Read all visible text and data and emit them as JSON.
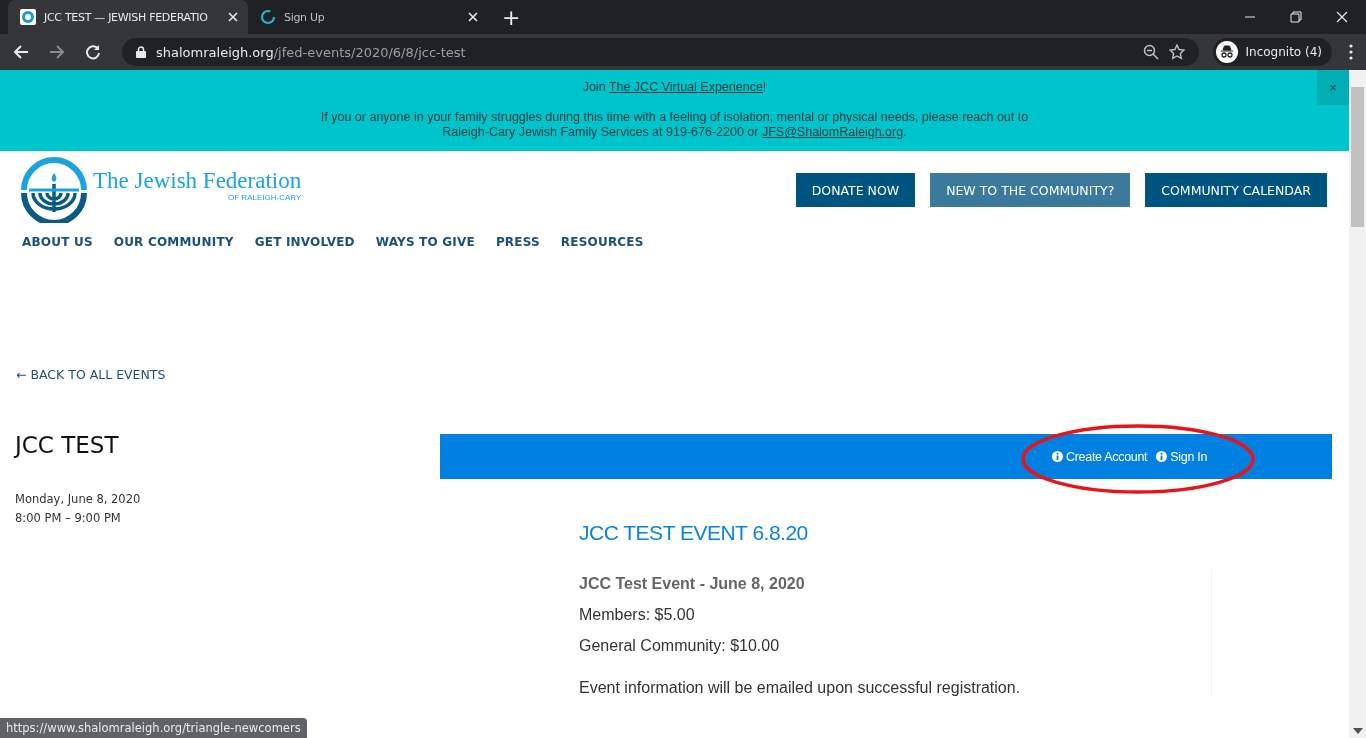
{
  "browser": {
    "tabs": [
      {
        "title": "JCC TEST — JEWISH FEDERATIO",
        "selected": true
      },
      {
        "title": "Sign Up",
        "selected": false
      }
    ],
    "new_tab": "+",
    "address": {
      "domain": "shalomraleigh.org",
      "path": "/jfed-events/2020/6/8/jcc-test"
    },
    "profile": "Incognito (4)"
  },
  "banner": {
    "lines": [
      [
        {
          "text": "Join ",
          "link": false
        },
        {
          "text": "The JCC Virtual Experience",
          "link": true
        },
        {
          "text": "!",
          "link": false
        }
      ],
      [
        {
          "text": "If you or anyone in your family struggles during this time with a feeling of isolation, mental or physical needs, please reach out to",
          "link": false
        }
      ],
      [
        {
          "text": "Raleigh-Cary Jewish Family Services at 919-676-2200 or ",
          "link": false
        },
        {
          "text": "JFS@ShalomRaleigh.org",
          "link": true
        },
        {
          "text": ".",
          "link": false
        }
      ]
    ],
    "close": "×"
  },
  "logo": {
    "title": "The Jewish Federation",
    "subtitle": "OF RALEIGH-CARY"
  },
  "header_buttons": [
    {
      "label": "DONATE NOW",
      "hovered": false
    },
    {
      "label": "NEW TO THE COMMUNITY?",
      "hovered": true
    },
    {
      "label": "COMMUNITY CALENDAR",
      "hovered": false
    }
  ],
  "nav": [
    "ABOUT US",
    "OUR COMMUNITY",
    "GET INVOLVED",
    "WAYS TO GIVE",
    "PRESS",
    "RESOURCES"
  ],
  "back_link": "← BACK TO ALL EVENTS",
  "event": {
    "title": "JCC TEST",
    "date": "Monday, June 8, 2020",
    "time": "8:00 PM – 9:00 PM"
  },
  "registration": {
    "links": [
      "Create Account",
      "Sign In"
    ],
    "circled": true,
    "title": "JCC TEST EVENT 6.8.20",
    "heading": "JCC Test Event - June 8, 2020",
    "lines": [
      "Members: $5.00",
      "General Community: $10.00"
    ],
    "note": "Event information will be emailed upon successful registration."
  },
  "status_url": "https://www.shalomraleigh.org/triangle-newcomers"
}
